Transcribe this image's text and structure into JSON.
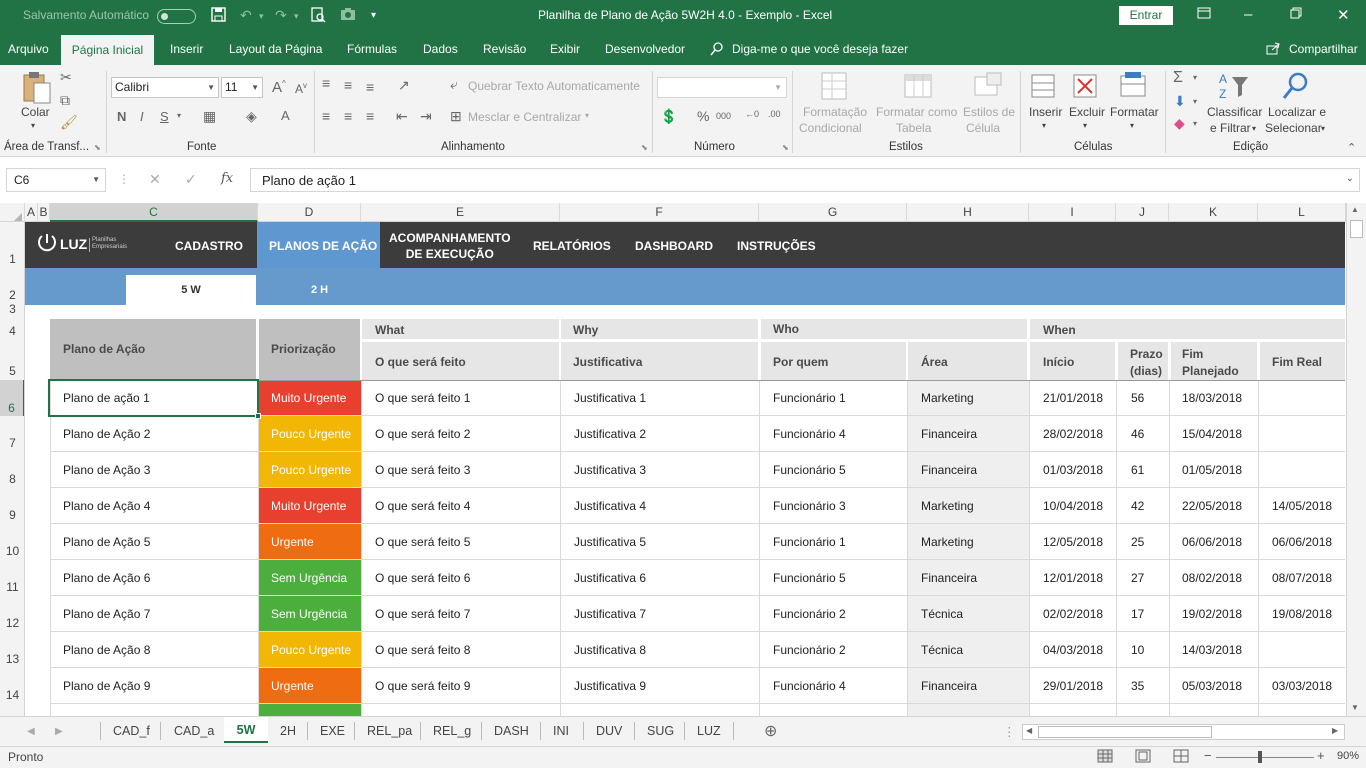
{
  "titlebar": {
    "autosave": "Salvamento Automático",
    "title": "Planilha de Plano de Ação 5W2H 4.0 - Exemplo  -  Excel",
    "signin": "Entrar"
  },
  "menu": {
    "tabs": [
      "Arquivo",
      "Página Inicial",
      "Inserir",
      "Layout da Página",
      "Fórmulas",
      "Dados",
      "Revisão",
      "Exibir",
      "Desenvolvedor"
    ],
    "tell_me": "Diga-me o que você deseja fazer",
    "share": "Compartilhar"
  },
  "ribbon": {
    "paste": "Colar",
    "clipboard": "Área de Transf...",
    "font_name": "Calibri",
    "font_size": "11",
    "font_group": "Fonte",
    "wrap_text": "Quebrar Texto Automaticamente",
    "merge_center": "Mesclar e Centralizar",
    "alignment_group": "Alinhamento",
    "number_group": "Número",
    "cond_format": [
      "Formatação",
      "Condicional"
    ],
    "format_table": [
      "Formatar como",
      "Tabela"
    ],
    "cell_styles": [
      "Estilos de",
      "Célula"
    ],
    "styles_group": "Estilos",
    "insert": "Inserir",
    "delete": "Excluir",
    "format": "Formatar",
    "cells_group": "Células",
    "sort_filter": [
      "Classificar",
      "e Filtrar"
    ],
    "find_select": [
      "Localizar e",
      "Selecionar"
    ],
    "editing_group": "Edição"
  },
  "formula_bar": {
    "name_box": "C6",
    "content": "Plano de ação 1"
  },
  "columns": [
    "A",
    "B",
    "C",
    "D",
    "E",
    "F",
    "G",
    "H",
    "I",
    "J",
    "K",
    "L"
  ],
  "rows": [
    "1",
    "2",
    "3",
    "4",
    "5",
    "6",
    "7",
    "8",
    "9",
    "10",
    "11",
    "12",
    "13",
    "14"
  ],
  "sheet_nav": {
    "logo": "LUZ",
    "logo_sub": [
      "Planilhas",
      "Empresariais"
    ],
    "links": [
      "CADASTRO",
      "PLANOS DE AÇÃO",
      "ACOMPANHAMENTO",
      "DE EXECUÇÃO",
      "RELATÓRIOS",
      "DASHBOARD",
      "INSTRUÇÕES"
    ],
    "tab_5w": "5 W",
    "tab_2h": "2 H"
  },
  "table": {
    "headers": {
      "plan": "Plano de Ação",
      "priority": "Priorização",
      "what": "What",
      "what_sub": "O que será feito",
      "why": "Why",
      "why_sub": "Justificativa",
      "who": "Who",
      "who_sub": "Por quem",
      "area": "Área",
      "when": "When",
      "start": "Início",
      "deadline": [
        "Prazo",
        "(dias)"
      ],
      "planned_end": [
        "Fim",
        "Planejado"
      ],
      "real_end": "Fim Real"
    },
    "rows": [
      {
        "plan": "Plano de ação 1",
        "priority": "Muito Urgente",
        "what": "O que será feito 1",
        "why": "Justificativa 1",
        "who": "Funcionário 1",
        "area": "Marketing",
        "start": "21/01/2018",
        "days": "56",
        "planned": "18/03/2018",
        "real": ""
      },
      {
        "plan": "Plano de Ação 2",
        "priority": "Pouco Urgente",
        "what": "O que será feito 2",
        "why": "Justificativa 2",
        "who": "Funcionário 4",
        "area": "Financeira",
        "start": "28/02/2018",
        "days": "46",
        "planned": "15/04/2018",
        "real": ""
      },
      {
        "plan": "Plano de Ação 3",
        "priority": "Pouco Urgente",
        "what": "O que será feito 3",
        "why": "Justificativa 3",
        "who": "Funcionário 5",
        "area": "Financeira",
        "start": "01/03/2018",
        "days": "61",
        "planned": "01/05/2018",
        "real": ""
      },
      {
        "plan": "Plano de Ação 4",
        "priority": "Muito Urgente",
        "what": "O que será feito 4",
        "why": "Justificativa 4",
        "who": "Funcionário 3",
        "area": "Marketing",
        "start": "10/04/2018",
        "days": "42",
        "planned": "22/05/2018",
        "real": "14/05/2018"
      },
      {
        "plan": "Plano de Ação 5",
        "priority": "Urgente",
        "what": "O que será feito 5",
        "why": "Justificativa 5",
        "who": "Funcionário 1",
        "area": "Marketing",
        "start": "12/05/2018",
        "days": "25",
        "planned": "06/06/2018",
        "real": "06/06/2018"
      },
      {
        "plan": "Plano de Ação 6",
        "priority": "Sem Urgência",
        "what": "O que será feito 6",
        "why": "Justificativa 6",
        "who": "Funcionário 5",
        "area": "Financeira",
        "start": "12/01/2018",
        "days": "27",
        "planned": "08/02/2018",
        "real": "08/07/2018"
      },
      {
        "plan": "Plano de Ação 7",
        "priority": "Sem Urgência",
        "what": "O que será feito 7",
        "why": "Justificativa 7",
        "who": "Funcionário 2",
        "area": "Técnica",
        "start": "02/02/2018",
        "days": "17",
        "planned": "19/02/2018",
        "real": "19/08/2018"
      },
      {
        "plan": "Plano de Ação 8",
        "priority": "Pouco Urgente",
        "what": "O que será feito 8",
        "why": "Justificativa 8",
        "who": "Funcionário 2",
        "area": "Técnica",
        "start": "04/03/2018",
        "days": "10",
        "planned": "14/03/2018",
        "real": ""
      },
      {
        "plan": "Plano de Ação 9",
        "priority": "Urgente",
        "what": "O que será feito 9",
        "why": "Justificativa 9",
        "who": "Funcionário 4",
        "area": "Financeira",
        "start": "29/01/2018",
        "days": "35",
        "planned": "05/03/2018",
        "real": "03/03/2018"
      }
    ]
  },
  "priority_colors": {
    "Muito Urgente": "#e8402f",
    "Pouco Urgente": "#f2b705",
    "Urgente": "#ef6c10",
    "Sem Urgência": "#4caf3d"
  },
  "sheet_tabs": [
    "CAD_f",
    "CAD_a",
    "5W",
    "2H",
    "EXE",
    "REL_pa",
    "REL_g",
    "DASH",
    "INI",
    "DUV",
    "SUG",
    "LUZ"
  ],
  "active_sheet": "5W",
  "status": {
    "ready": "Pronto",
    "zoom": "90%"
  },
  "colors": {
    "excel_green": "#217346",
    "nav_dark": "#3c3c3c",
    "nav_blue": "#6699cc",
    "nav_active": "#5f97d1"
  }
}
